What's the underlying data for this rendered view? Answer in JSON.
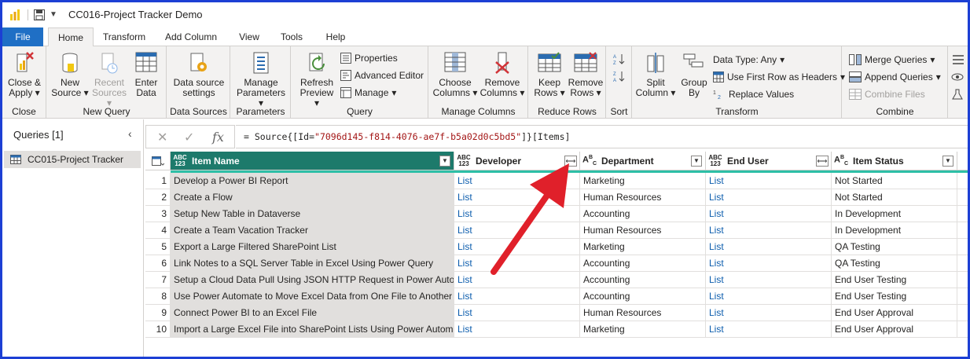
{
  "window": {
    "title": "CC016-Project Tracker Demo"
  },
  "tabs": [
    "File",
    "Home",
    "Transform",
    "Add Column",
    "View",
    "Tools",
    "Help"
  ],
  "ribbon": {
    "close": {
      "button": [
        "Close &",
        "Apply"
      ],
      "label": "Close"
    },
    "new_query": {
      "new_source": [
        "New",
        "Source"
      ],
      "recent_sources": [
        "Recent",
        "Sources"
      ],
      "enter_data": [
        "Enter",
        "Data"
      ],
      "label": "New Query"
    },
    "data_sources": {
      "settings": [
        "Data source",
        "settings"
      ],
      "label": "Data Sources"
    },
    "parameters": {
      "manage": [
        "Manage",
        "Parameters"
      ],
      "label": "Parameters"
    },
    "query": {
      "refresh": [
        "Refresh",
        "Preview"
      ],
      "properties": "Properties",
      "advanced_editor": "Advanced Editor",
      "manage": "Manage",
      "label": "Query"
    },
    "manage_columns": {
      "choose": [
        "Choose",
        "Columns"
      ],
      "remove": [
        "Remove",
        "Columns"
      ],
      "label": "Manage Columns"
    },
    "reduce_rows": {
      "keep": [
        "Keep",
        "Rows"
      ],
      "remove": [
        "Remove",
        "Rows"
      ],
      "label": "Reduce Rows"
    },
    "sort": {
      "label": "Sort"
    },
    "transform": {
      "split": [
        "Split",
        "Column"
      ],
      "group": [
        "Group",
        "By"
      ],
      "data_type": "Data Type: Any",
      "first_row": "Use First Row as Headers",
      "replace": "Replace Values",
      "label": "Transform"
    },
    "combine": {
      "merge": "Merge Queries",
      "append": "Append Queries",
      "files": "Combine Files",
      "label": "Combine"
    }
  },
  "queries": {
    "header": "Queries [1]",
    "items": [
      "CC015-Project Tracker"
    ]
  },
  "formula": {
    "prefix": "= Source{[Id=",
    "id": "\"7096d145-f814-4076-ae7f-b5a02d0c5bd5\"",
    "suffix": "]}[Items]"
  },
  "table": {
    "columns": [
      {
        "type": "ABC\n123",
        "name": "Item Name"
      },
      {
        "type": "ABC\n123",
        "name": "Developer"
      },
      {
        "type": "ABC",
        "name": "Department"
      },
      {
        "type": "ABC\n123",
        "name": "End User"
      },
      {
        "type": "ABC",
        "name": "Item Status"
      }
    ],
    "rows": [
      {
        "n": "1",
        "item": "Develop a Power BI Report",
        "dev": "List",
        "dept": "Marketing",
        "user": "List",
        "status": "Not Started"
      },
      {
        "n": "2",
        "item": "Create a Flow",
        "dev": "List",
        "dept": "Human Resources",
        "user": "List",
        "status": "Not Started"
      },
      {
        "n": "3",
        "item": "Setup New Table in Dataverse",
        "dev": "List",
        "dept": "Accounting",
        "user": "List",
        "status": "In Development"
      },
      {
        "n": "4",
        "item": "Create a Team Vacation Tracker",
        "dev": "List",
        "dept": "Human Resources",
        "user": "List",
        "status": "In Development"
      },
      {
        "n": "5",
        "item": "Export a Large Filtered SharePoint List",
        "dev": "List",
        "dept": "Marketing",
        "user": "List",
        "status": "QA Testing"
      },
      {
        "n": "6",
        "item": "Link Notes to a SQL Server Table in Excel Using Power Query",
        "dev": "List",
        "dept": "Accounting",
        "user": "List",
        "status": "QA Testing"
      },
      {
        "n": "7",
        "item": "Setup a Cloud Data Pull Using JSON HTTP Request in Power Automate",
        "dev": "List",
        "dept": "Accounting",
        "user": "List",
        "status": "End User Testing"
      },
      {
        "n": "8",
        "item": "Use Power Automate to Move Excel Data from One File to Another",
        "dev": "List",
        "dept": "Accounting",
        "user": "List",
        "status": "End User Testing"
      },
      {
        "n": "9",
        "item": "Connect Power BI to an Excel File",
        "dev": "List",
        "dept": "Human Resources",
        "user": "List",
        "status": "End User Approval"
      },
      {
        "n": "10",
        "item": "Import a Large Excel File into SharePoint Lists Using Power Automate",
        "dev": "List",
        "dept": "Marketing",
        "user": "List",
        "status": "End User Approval"
      }
    ]
  },
  "colors": {
    "accent": "#1f6fc5",
    "selected_header": "#1d7a6b",
    "quality_bar": "#2dbfa6",
    "arrow": "#e0202a",
    "frame_border": "#1c3fd4"
  }
}
